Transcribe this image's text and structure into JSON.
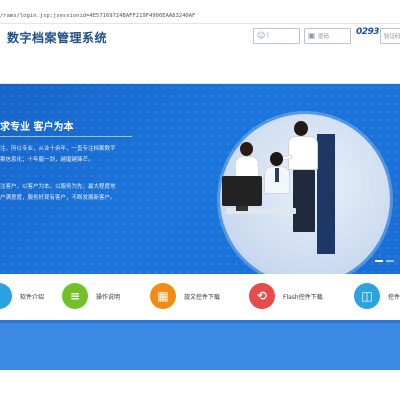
{
  "browser": {
    "url": "/rams/login.jsp;jsessionid=4E57169724BAFF219F4900EAA83240AF"
  },
  "header": {
    "title": "数字档案管理系统"
  },
  "login": {
    "username_placeholder": "|",
    "password_placeholder": "密码",
    "captcha_image_text": "0293",
    "captcha_placeholder": "验证码"
  },
  "banner": {
    "slogan": "求专业  客户为本",
    "paragraph1": [
      "注，所以专业，从业十余年，一直专注档案数字",
      "案信息化；十年磨一剑，越磨越锋芒。"
    ],
    "paragraph2": [
      "注客户，以客户为本，以服务为先，最大程度地",
      "户满意度，服务好现有客户，不断发展新客户。"
    ]
  },
  "nav": {
    "items": [
      {
        "label": "软件介绍",
        "icon": "doc-icon",
        "color": "#2aa3e0",
        "glyph": ""
      },
      {
        "label": "操作说明",
        "icon": "list-icon",
        "color": "#72c12a",
        "glyph": "≡"
      },
      {
        "label": "旋文控件下载",
        "icon": "grid-icon",
        "color": "#f28b14",
        "glyph": "▦"
      },
      {
        "label": "Flash控件下载",
        "icon": "flash-icon",
        "color": "#e84a4a",
        "glyph": "⟲"
      },
      {
        "label": "控件",
        "icon": "bookmark-icon",
        "color": "#2aa3e0",
        "glyph": "◫"
      }
    ]
  },
  "colors": {
    "title": "#24508a",
    "banner": "#1b76dc",
    "footer": "#3c8ae6"
  }
}
